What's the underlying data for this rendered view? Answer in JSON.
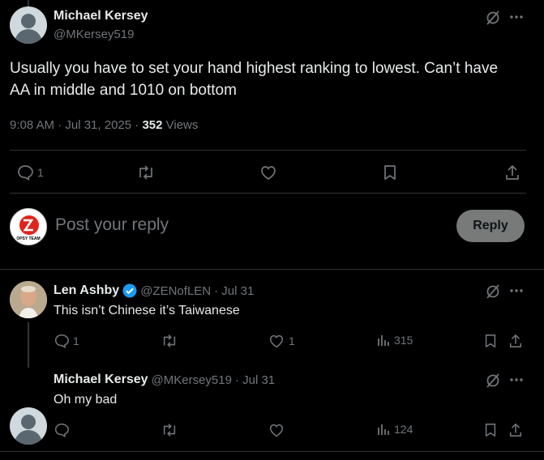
{
  "main_post": {
    "author_name": "Michael Kersey",
    "author_handle": "@MKersey519",
    "text_line1": "Usually you have to set your hand highest ranking to lowest. Can’t have",
    "text_line2": "AA in middle and 1010 on bottom",
    "timestamp": "9:08 AM · Jul 31, 2025 · ",
    "views_count": "352",
    "views_label": " Views",
    "reply_count": "1"
  },
  "composer": {
    "placeholder": "Post your reply",
    "reply_label": "Reply",
    "avatar_text": "OPSY TEAM"
  },
  "replies": [
    {
      "author_name": "Len Ashby",
      "author_handle": "@ZENofLEN",
      "date": "· Jul 31",
      "text": "This isn’t Chinese it’s Taiwanese",
      "reply_count": "1",
      "like_count": "1",
      "views": "315",
      "verified": true
    },
    {
      "author_name": "Michael Kersey",
      "author_handle": "@MKersey519",
      "date": "· Jul 31",
      "text": "Oh my bad",
      "reply_count": "",
      "like_count": "",
      "views": "124",
      "verified": false
    }
  ],
  "colors": {
    "background": "#000000",
    "text": "#e7e9ea",
    "muted": "#71767b",
    "divider": "#2f3336",
    "verified": "#1d9bf0",
    "reply_button": "#787a7a"
  }
}
